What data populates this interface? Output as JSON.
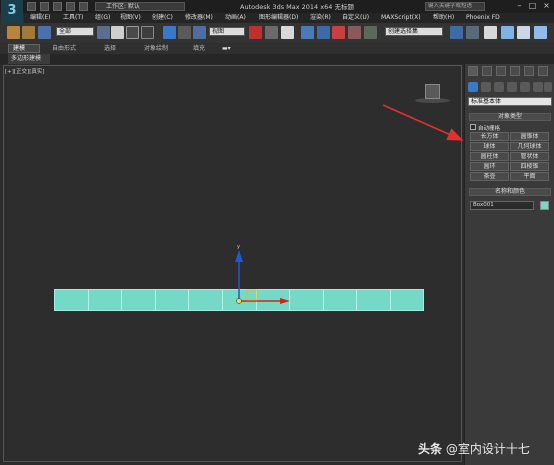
{
  "title_bar": {
    "app_title": "Autodesk 3ds Max  2014 x64   无标题",
    "workspace": "工作区: 默认",
    "search_placeholder": "键入关键字或短语",
    "minimize": "–",
    "maximize": "□",
    "close": "×"
  },
  "menu": {
    "items": [
      "编辑(E)",
      "工具(T)",
      "组(G)",
      "视图(V)",
      "创建(C)",
      "修改器(M)",
      "动画(A)",
      "图形编辑器(D)",
      "渲染(R)",
      "自定义(U)",
      "MAXScript(X)",
      "帮助(H)",
      "Phoenix FD"
    ]
  },
  "toolbar": {
    "selection_filter": "全部",
    "reference_coord": "视图",
    "named_selection": "创建选择集"
  },
  "ribbon": {
    "tabs": [
      "建模",
      "自由形式",
      "选择",
      "对象绘制",
      "填充"
    ],
    "sub_label": "多边形建模"
  },
  "viewport": {
    "label": "[+][正交][真实]"
  },
  "command_panel": {
    "subcategory": "标准基本体",
    "object_type": {
      "title": "对象类型",
      "autogrid": "自动栅格",
      "buttons": [
        "长方体",
        "圆锥体",
        "球体",
        "几何球体",
        "圆柱体",
        "管状体",
        "圆环",
        "四棱锥",
        "茶壶",
        "平面"
      ]
    },
    "name_color": {
      "title": "名称和颜色",
      "name": "Box001",
      "color": "#76d9c8"
    }
  },
  "watermark": {
    "prefix": "头条",
    "handle": "@室内设计十七"
  },
  "colors": {
    "object": "#76d9c8",
    "arrow": "#e03030",
    "axis_y": "#1e5ad8",
    "axis_x": "#d82020"
  }
}
